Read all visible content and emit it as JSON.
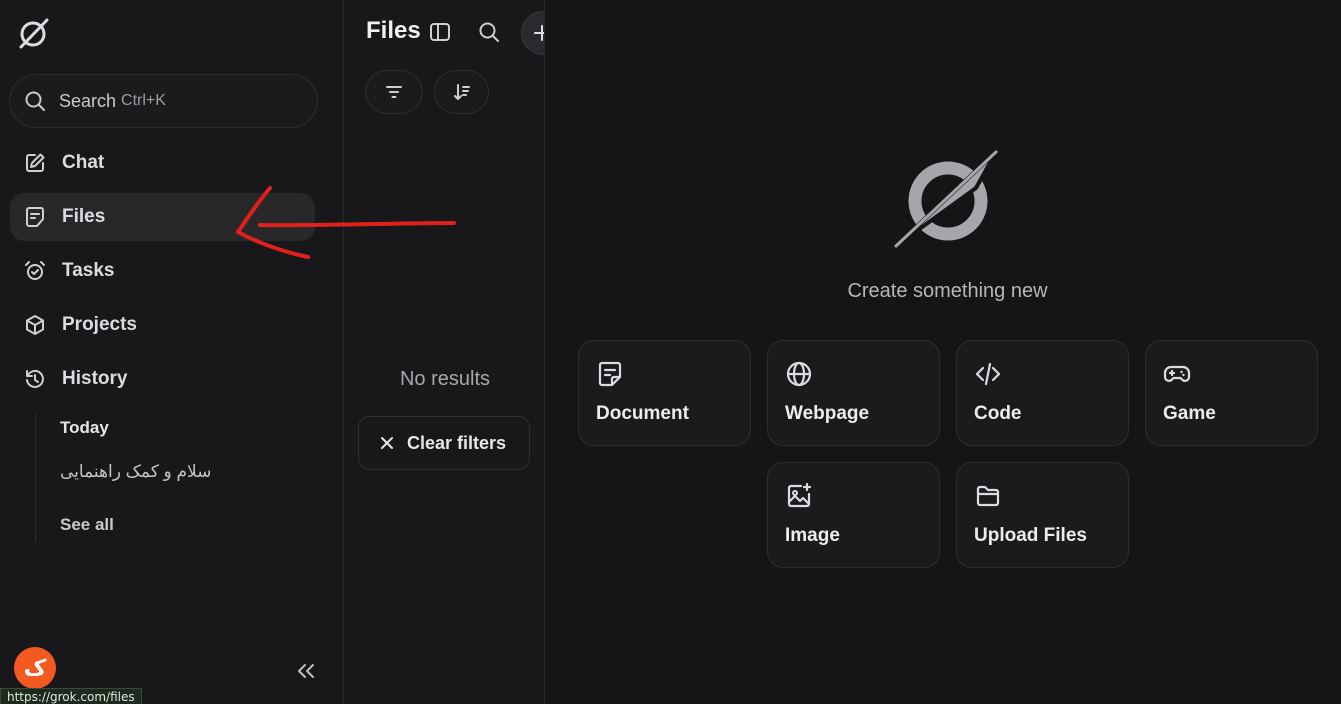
{
  "sidebar": {
    "search": {
      "label": "Search",
      "shortcut": "Ctrl+K"
    },
    "nav": [
      {
        "label": "Chat",
        "icon": "edit-icon"
      },
      {
        "label": "Files",
        "icon": "file-note-icon",
        "active": true
      },
      {
        "label": "Tasks",
        "icon": "alarm-clock-icon"
      },
      {
        "label": "Projects",
        "icon": "cube-icon"
      },
      {
        "label": "History",
        "icon": "history-icon"
      }
    ],
    "history": {
      "group": "Today",
      "items": [
        "سلام و کمک راهنمایی"
      ],
      "see_all": "See all"
    },
    "avatar_letter": "ک",
    "status_url": "https://grok.com/files"
  },
  "files_panel": {
    "title": "Files",
    "no_results": "No results",
    "clear_filters": "Clear filters"
  },
  "main": {
    "create_title": "Create something new",
    "cards": [
      {
        "label": "Document",
        "icon": "document-icon"
      },
      {
        "label": "Webpage",
        "icon": "globe-icon"
      },
      {
        "label": "Code",
        "icon": "code-icon"
      },
      {
        "label": "Game",
        "icon": "gamepad-icon"
      },
      {
        "label": "Image",
        "icon": "image-sparkle-icon"
      },
      {
        "label": "Upload Files",
        "icon": "folder-icon"
      }
    ]
  },
  "colors": {
    "background": "#151517",
    "sidebar": "#18181a",
    "active_item": "#28282b",
    "avatar": "#f25a22",
    "annotation": "#e0201c"
  }
}
